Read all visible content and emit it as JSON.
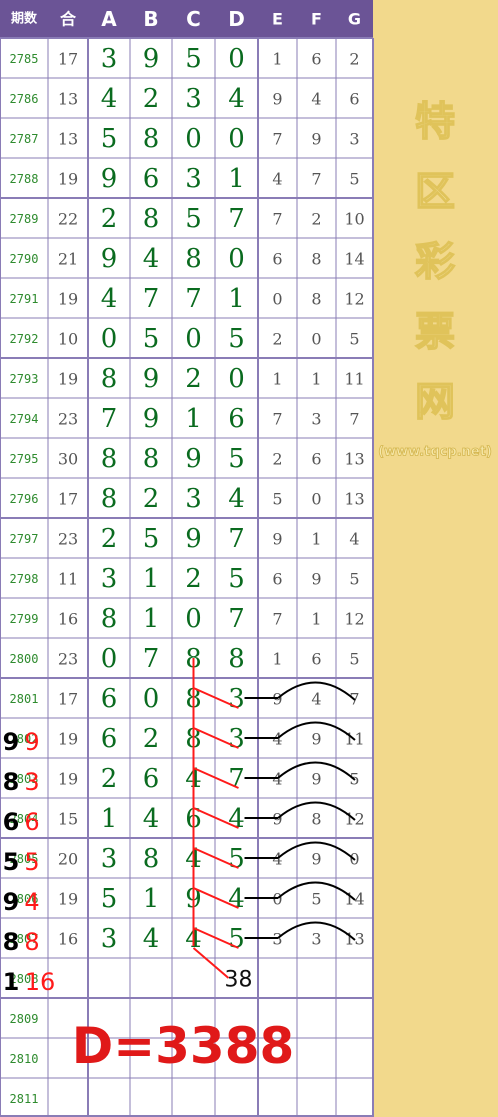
{
  "chart_data": {
    "type": "table",
    "columns": [
      "期数",
      "合",
      "A",
      "B",
      "C",
      "D",
      "E",
      "F",
      "G"
    ],
    "rows": [
      {
        "issue": "2785",
        "sum": "17",
        "main": [
          "3",
          "9",
          "5",
          "0"
        ],
        "extra": [
          "1",
          "6",
          "2"
        ]
      },
      {
        "issue": "2786",
        "sum": "13",
        "main": [
          "4",
          "2",
          "3",
          "4"
        ],
        "extra": [
          "9",
          "4",
          "6"
        ]
      },
      {
        "issue": "2787",
        "sum": "13",
        "main": [
          "5",
          "8",
          "0",
          "0"
        ],
        "extra": [
          "7",
          "9",
          "3"
        ]
      },
      {
        "issue": "2788",
        "sum": "19",
        "main": [
          "9",
          "6",
          "3",
          "1"
        ],
        "extra": [
          "4",
          "7",
          "5"
        ]
      },
      {
        "issue": "2789",
        "sum": "22",
        "main": [
          "2",
          "8",
          "5",
          "7"
        ],
        "extra": [
          "7",
          "2",
          "10"
        ]
      },
      {
        "issue": "2790",
        "sum": "21",
        "main": [
          "9",
          "4",
          "8",
          "0"
        ],
        "extra": [
          "6",
          "8",
          "14"
        ]
      },
      {
        "issue": "2791",
        "sum": "19",
        "main": [
          "4",
          "7",
          "7",
          "1"
        ],
        "extra": [
          "0",
          "8",
          "12"
        ]
      },
      {
        "issue": "2792",
        "sum": "10",
        "main": [
          "0",
          "5",
          "0",
          "5"
        ],
        "extra": [
          "2",
          "0",
          "5"
        ]
      },
      {
        "issue": "2793",
        "sum": "19",
        "main": [
          "8",
          "9",
          "2",
          "0"
        ],
        "extra": [
          "1",
          "1",
          "11"
        ]
      },
      {
        "issue": "2794",
        "sum": "23",
        "main": [
          "7",
          "9",
          "1",
          "6"
        ],
        "extra": [
          "7",
          "3",
          "7"
        ]
      },
      {
        "issue": "2795",
        "sum": "30",
        "main": [
          "8",
          "8",
          "9",
          "5"
        ],
        "extra": [
          "2",
          "6",
          "13"
        ]
      },
      {
        "issue": "2796",
        "sum": "17",
        "main": [
          "8",
          "2",
          "3",
          "4"
        ],
        "extra": [
          "5",
          "0",
          "13"
        ]
      },
      {
        "issue": "2797",
        "sum": "23",
        "main": [
          "2",
          "5",
          "9",
          "7"
        ],
        "extra": [
          "9",
          "1",
          "4"
        ]
      },
      {
        "issue": "2798",
        "sum": "11",
        "main": [
          "3",
          "1",
          "2",
          "5"
        ],
        "extra": [
          "6",
          "9",
          "5"
        ]
      },
      {
        "issue": "2799",
        "sum": "16",
        "main": [
          "8",
          "1",
          "0",
          "7"
        ],
        "extra": [
          "7",
          "1",
          "12"
        ]
      },
      {
        "issue": "2800",
        "sum": "23",
        "main": [
          "0",
          "7",
          "8",
          "8"
        ],
        "extra": [
          "1",
          "6",
          "5"
        ]
      },
      {
        "issue": "2801",
        "sum": "17",
        "main": [
          "6",
          "0",
          "8",
          "3"
        ],
        "extra": [
          "9",
          "4",
          "7"
        ]
      },
      {
        "issue": "2802",
        "sum": "19",
        "main": [
          "6",
          "2",
          "8",
          "3"
        ],
        "extra": [
          "4",
          "9",
          "11"
        ]
      },
      {
        "issue": "2803",
        "sum": "19",
        "main": [
          "2",
          "6",
          "4",
          "7"
        ],
        "extra": [
          "4",
          "9",
          "5"
        ]
      },
      {
        "issue": "2804",
        "sum": "15",
        "main": [
          "1",
          "4",
          "6",
          "4"
        ],
        "extra": [
          "9",
          "8",
          "12"
        ]
      },
      {
        "issue": "2805",
        "sum": "20",
        "main": [
          "3",
          "8",
          "4",
          "5"
        ],
        "extra": [
          "4",
          "9",
          "0"
        ]
      },
      {
        "issue": "2806",
        "sum": "19",
        "main": [
          "5",
          "1",
          "9",
          "4"
        ],
        "extra": [
          "0",
          "5",
          "14"
        ]
      },
      {
        "issue": "2807",
        "sum": "16",
        "main": [
          "3",
          "4",
          "4",
          "5"
        ],
        "extra": [
          "3",
          "3",
          "13"
        ]
      },
      {
        "issue": "2808",
        "sum": "",
        "main": [
          "",
          "",
          "",
          ""
        ],
        "extra": [
          "",
          "",
          ""
        ]
      },
      {
        "issue": "2809",
        "sum": "",
        "main": [
          "",
          "",
          "",
          ""
        ],
        "extra": [
          "",
          "",
          ""
        ]
      },
      {
        "issue": "2810",
        "sum": "",
        "main": [
          "",
          "",
          "",
          ""
        ],
        "extra": [
          "",
          "",
          ""
        ]
      },
      {
        "issue": "2811",
        "sum": "",
        "main": [
          "",
          "",
          "",
          ""
        ],
        "extra": [
          "",
          "",
          ""
        ]
      }
    ],
    "annotations": {
      "row_notes": [
        {
          "issue": "2802",
          "black": "9",
          "red": "9"
        },
        {
          "issue": "2803",
          "black": "8",
          "red": "3"
        },
        {
          "issue": "2804",
          "black": "6",
          "red": "6"
        },
        {
          "issue": "2805",
          "black": "5",
          "red": "5"
        },
        {
          "issue": "2806",
          "black": "9",
          "red": "4"
        },
        {
          "issue": "2807",
          "black": "8",
          "red": "8"
        },
        {
          "issue": "2808",
          "black": "1",
          "red": "16"
        }
      ],
      "total_label": "38",
      "prediction": "D=3388"
    },
    "colors": {
      "header_bg": "#6b5496",
      "grid_line": "#8a7cb6",
      "issue_text": "#2e8b2e",
      "main_digit": "#0a6b1f",
      "side_panel": "#f2d98c",
      "annotation_red": "#ff1a1a"
    }
  },
  "brand": {
    "chars": [
      "特",
      "区",
      "彩",
      "票",
      "网"
    ],
    "url": "(www.tqcp.net)"
  }
}
